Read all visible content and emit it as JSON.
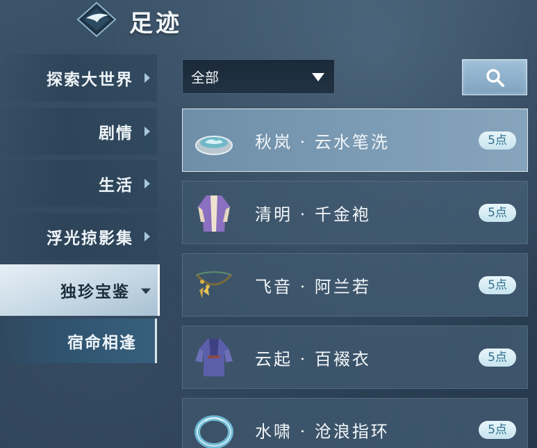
{
  "header": {
    "title": "足迹",
    "logo_icon": "emblem-icon"
  },
  "sidebar": {
    "items": [
      {
        "label": "探索大世界"
      },
      {
        "label": "剧情"
      },
      {
        "label": "生活"
      },
      {
        "label": "浮光掠影集"
      },
      {
        "label": "独珍宝鉴",
        "active": true
      },
      {
        "label": "宿命相逢",
        "sub": true
      }
    ]
  },
  "filter": {
    "selected": "全部",
    "search_icon": "search-icon"
  },
  "list": {
    "items": [
      {
        "name": "秋岚 · 云水笔洗",
        "points": "5点",
        "icon": "brush-washer-icon",
        "selected": true
      },
      {
        "name": "清明 · 千金袍",
        "points": "5点",
        "icon": "robe-icon"
      },
      {
        "name": "飞音 · 阿兰若",
        "points": "5点",
        "icon": "necklace-icon"
      },
      {
        "name": "云起 · 百裰衣",
        "points": "5点",
        "icon": "garment-icon"
      },
      {
        "name": "水啸 · 沧浪指环",
        "points": "5点",
        "icon": "ring-icon"
      }
    ]
  },
  "colors": {
    "background": "#2f4459",
    "active_tab": "#c6d8e5",
    "selected_row": "#7b9ab3",
    "badge_text": "#2f6f8c"
  }
}
